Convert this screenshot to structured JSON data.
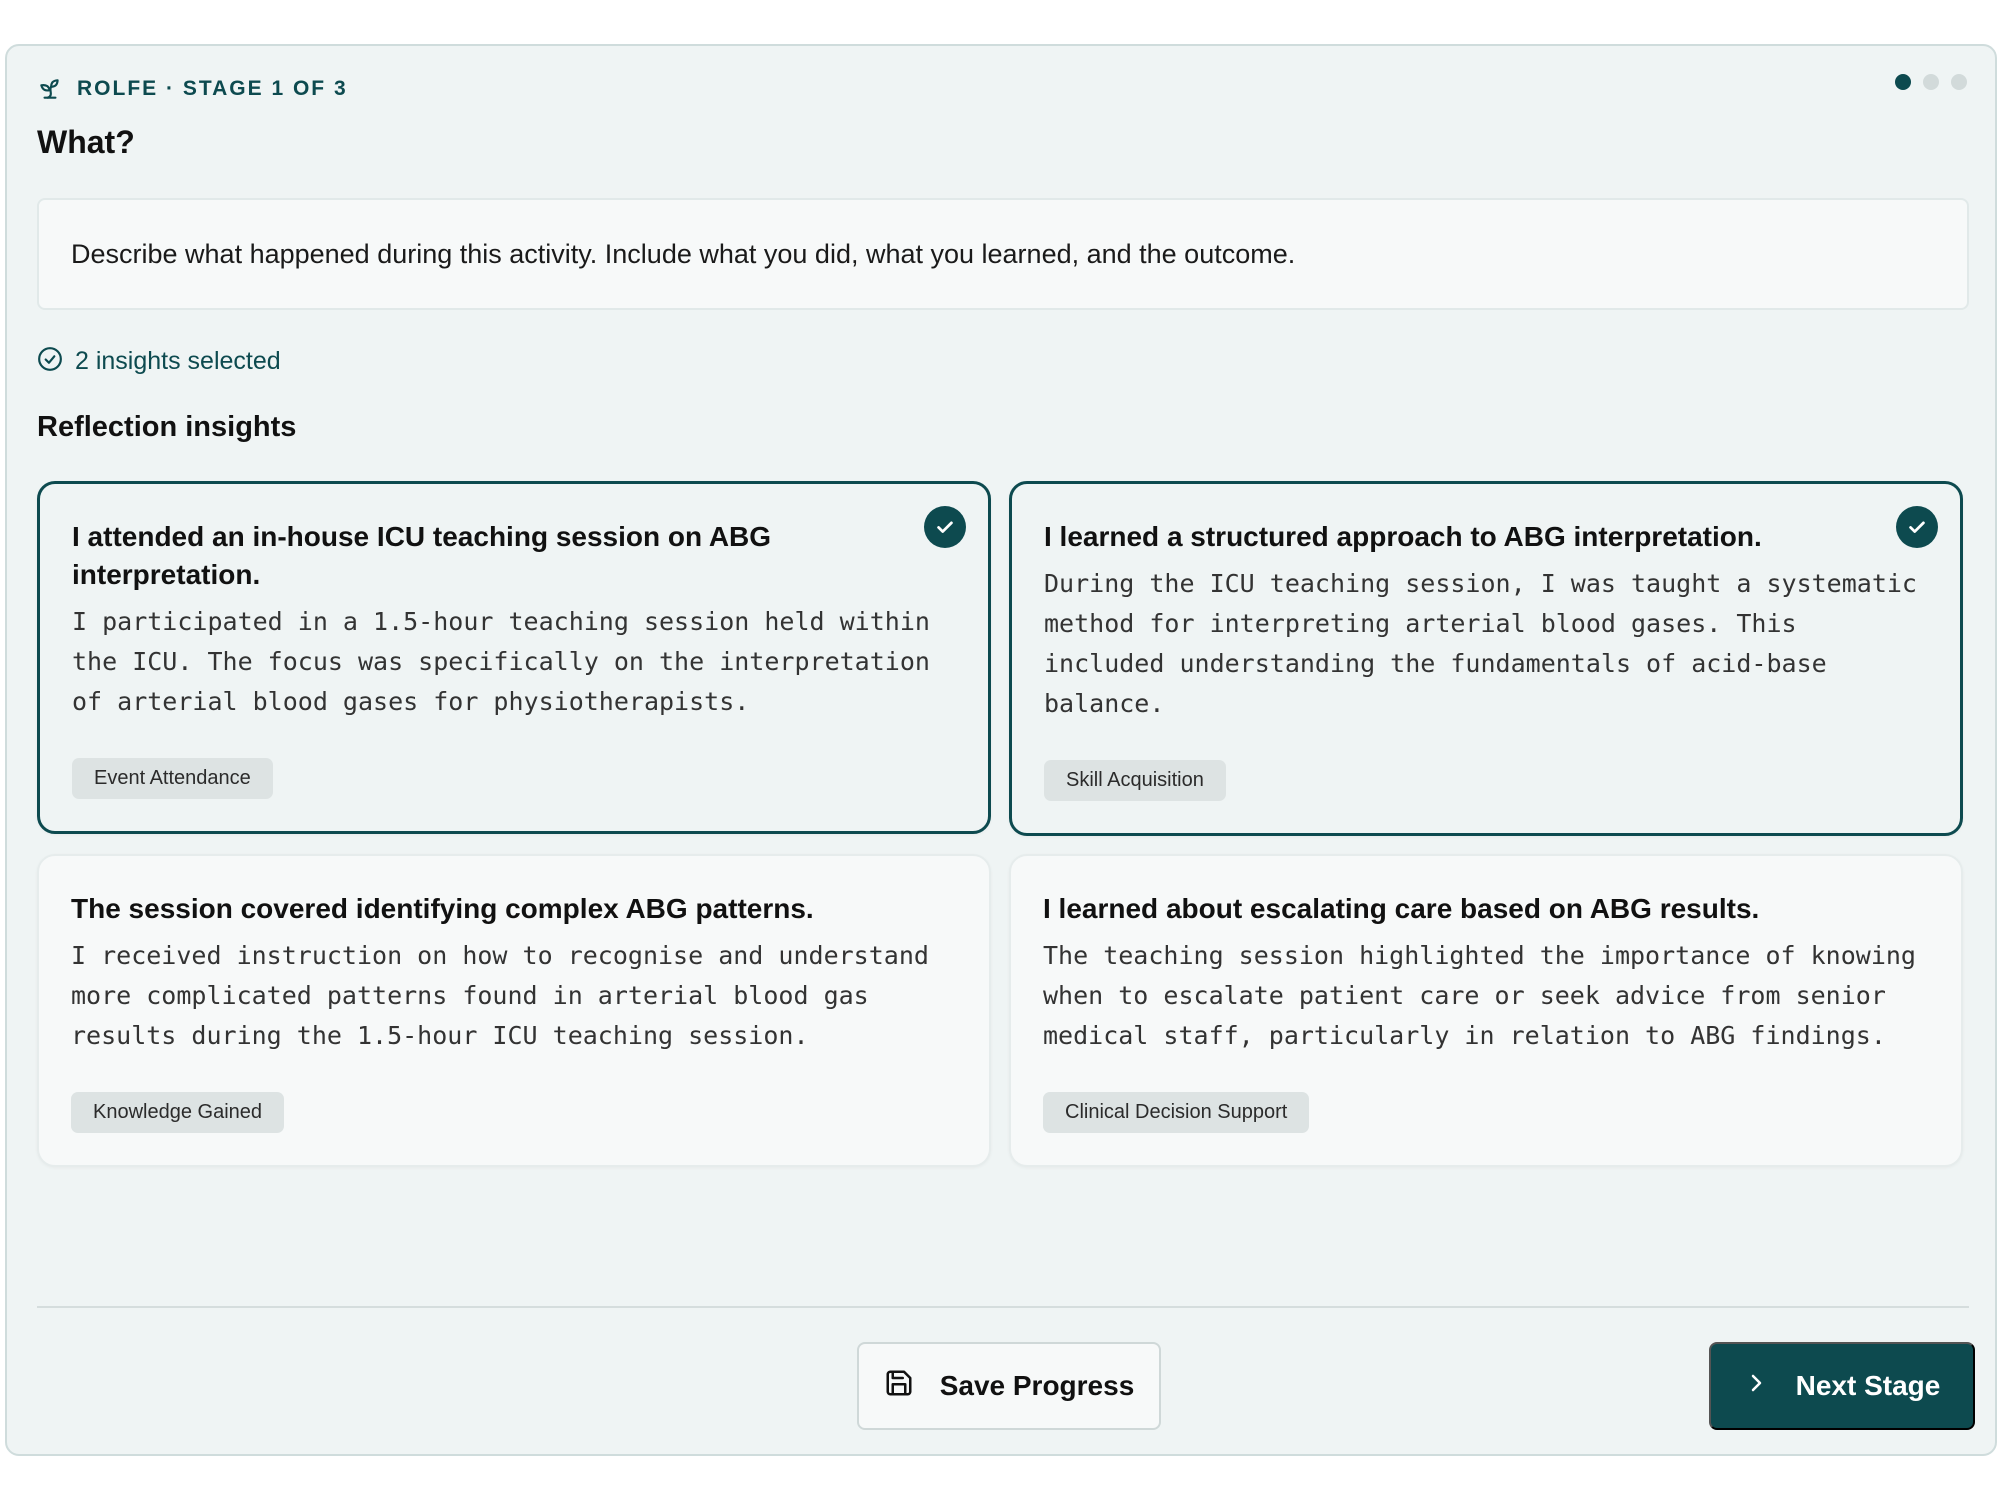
{
  "header": {
    "kicker": "ROLFE · STAGE 1 OF 3",
    "title": "What?",
    "stages_total": 3,
    "current_stage": 1
  },
  "prompt": "Describe what happened during this activity. Include what you did, what you learned, and the outcome.",
  "selection": {
    "summary": "2 insights selected"
  },
  "section_title": "Reflection insights",
  "insights": [
    {
      "title": "I attended an in-house ICU teaching session on ABG interpretation.",
      "body": "I participated in a 1.5-hour teaching session held within the ICU. The focus was specifically on the interpretation of arterial blood gases for physiotherapists.",
      "tag": "Event Attendance",
      "selected": true
    },
    {
      "title": "I learned a structured approach to ABG interpretation.",
      "body": "During the ICU teaching session, I was taught a systematic method for interpreting arterial blood gases. This included understanding the fundamentals of acid-base balance.",
      "tag": "Skill Acquisition",
      "selected": true
    },
    {
      "title": "The session covered identifying complex ABG patterns.",
      "body": "I received instruction on how to recognise and understand more complicated patterns found in arterial blood gas results during the 1.5-hour ICU teaching session.",
      "tag": "Knowledge Gained",
      "selected": false
    },
    {
      "title": "I learned about escalating care based on ABG results.",
      "body": "The teaching session highlighted the importance of knowing when to escalate patient care or seek advice from senior medical staff, particularly in relation to ABG findings.",
      "tag": "Clinical Decision Support",
      "selected": false
    }
  ],
  "footer": {
    "save_label": "Save Progress",
    "next_label": "Next Stage"
  },
  "colors": {
    "accent": "#0d4a4f",
    "panel_bg": "#eff4f4",
    "tag_bg": "#dde3e3"
  },
  "icons": {
    "kicker": "sprout-icon",
    "selected": "check-circle-icon",
    "card_selected": "check-icon",
    "save": "save-icon",
    "next": "chevron-right-icon"
  }
}
